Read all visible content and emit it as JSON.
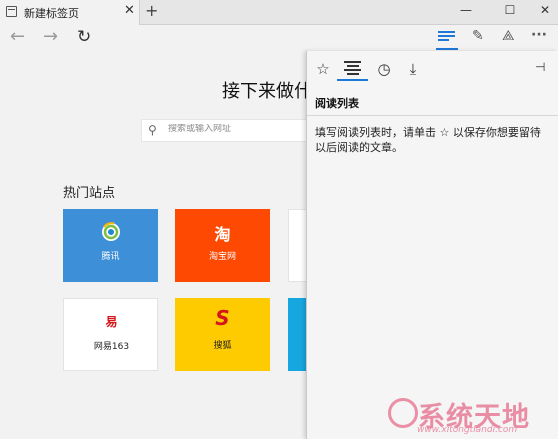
{
  "tab": {
    "title": "新建标签页",
    "close_icon": "close-icon",
    "new_tab_icon": "plus-icon"
  },
  "window": {
    "minimize": "—",
    "maximize": "☐",
    "close": "✕"
  },
  "nav": {
    "back_icon": "arrow-left-icon",
    "forward_icon": "arrow-right-icon",
    "refresh_icon": "refresh-icon"
  },
  "toolbar": {
    "hub_icon": "hub-icon",
    "note_icon": "web-note-icon",
    "share_icon": "share-icon",
    "more_label": "···"
  },
  "page": {
    "heading": "接下来做什",
    "search": {
      "placeholder": "搜索或输入网址"
    },
    "top_sites_heading": "热门站点",
    "tiles": [
      {
        "label": "腾讯",
        "color": "#3d8fd8"
      },
      {
        "label": "淘宝网",
        "logo": "淘",
        "color": "#fe4902"
      },
      {
        "label": "网易163",
        "logo": "易",
        "color": "#ffffff"
      },
      {
        "label": "搜狐",
        "logo": "S",
        "color": "#fecb00"
      }
    ]
  },
  "hub": {
    "tabs": [
      "favorites-star-icon",
      "reading-list-icon",
      "history-icon",
      "downloads-icon"
    ],
    "title": "阅读列表",
    "message": "填写阅读列表时，请单击 ☆ 以保存你想要留待以后阅读的文章。",
    "pin_icon": "pin-icon"
  },
  "watermark": {
    "text": "系统天地",
    "url": "www.xitongtiandi.com"
  },
  "colors": {
    "accent": "#1e78d7",
    "tencent": "#3d8fd8",
    "taobao": "#fe4902",
    "sohu": "#fecb00",
    "watermark": "#e87c98"
  }
}
